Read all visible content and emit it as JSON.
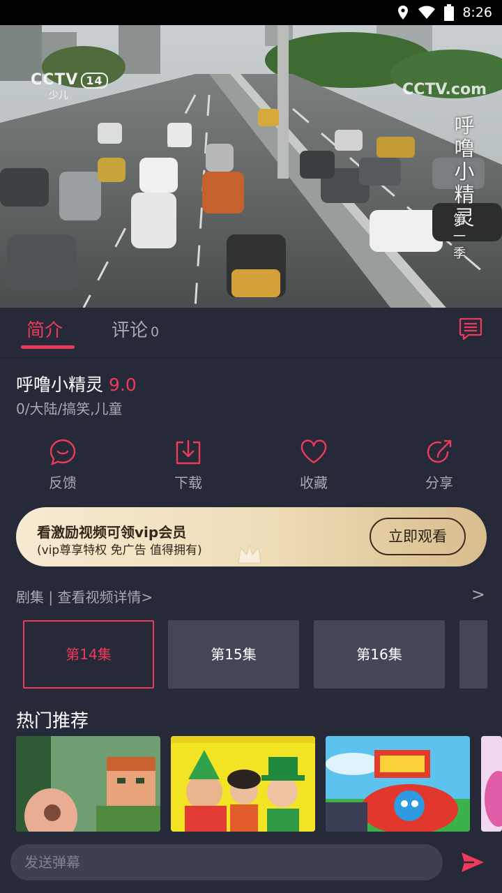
{
  "status_bar": {
    "time": "8:26"
  },
  "video": {
    "channel_logo": "CCTV",
    "channel_number": "14",
    "channel_sub": "少儿",
    "watermark": "CCTV.com",
    "title_vertical": "呼噜小精灵",
    "season_vertical": "第一季"
  },
  "tabs": {
    "intro": "简介",
    "comments": "评论",
    "comment_count": "0"
  },
  "show": {
    "title": "呼噜小精灵",
    "rating": "9.0",
    "meta": "0/大陆/搞笑,儿童"
  },
  "actions": [
    {
      "label": "反馈",
      "icon": "feedback-icon"
    },
    {
      "label": "下载",
      "icon": "download-icon"
    },
    {
      "label": "收藏",
      "icon": "heart-icon"
    },
    {
      "label": "分享",
      "icon": "share-icon"
    }
  ],
  "vip_banner": {
    "title": "看激励视频可领vip会员",
    "subtitle": "(vip尊享特权 免广告 值得拥有)",
    "button": "立即观看"
  },
  "episodes": {
    "header": "剧集 | 查看视频详情>",
    "more": ">",
    "items": [
      "第14集",
      "第15集",
      "第16集"
    ],
    "selected": "第14集"
  },
  "hot": {
    "title": "热门推荐"
  },
  "danmaku": {
    "placeholder": "发送弹幕"
  },
  "colors": {
    "accent": "#ee3a5a",
    "background": "#262938",
    "vip_gold": "#eedcb7"
  }
}
